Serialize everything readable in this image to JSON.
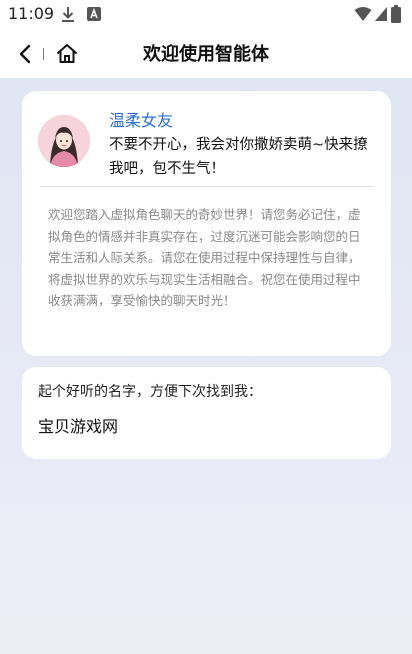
{
  "status_bar": {
    "time": "11:09",
    "left_icons": [
      "download-icon",
      "app-notification-icon"
    ],
    "right_icons": [
      "wifi-icon",
      "signal-icon",
      "battery-icon"
    ]
  },
  "nav": {
    "title": "欢迎使用智能体",
    "back_icon": "chevron-left-icon",
    "home_icon": "home-icon"
  },
  "character": {
    "name": "温柔女友",
    "greeting": "不要不开心，我会对你撒娇卖萌~快来撩我吧，包不生气！",
    "name_color": "#2e6fd6"
  },
  "disclaimer": "欢迎您踏入虚拟角色聊天的奇妙世界！请您务必记住，虚拟角色的情感并非真实存在，过度沉迷可能会影响您的日常生活和人际关系。请您在使用过程中保持理性与自律，将虚拟世界的欢乐与现实生活相融合。祝您在使用过程中收获满满，享受愉快的聊天时光！",
  "name_card": {
    "prompt": "起个好听的名字，方便下次找到我：",
    "value": "宝贝游戏网"
  }
}
